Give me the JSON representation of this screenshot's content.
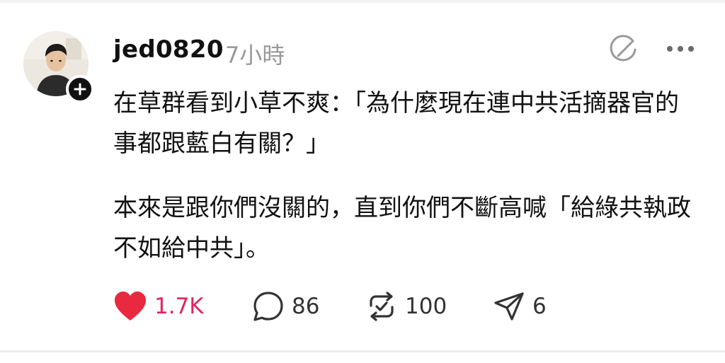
{
  "post": {
    "author": {
      "username": "jed0820",
      "timestamp": "7小時",
      "avatar_icon": "user-avatar-photo",
      "follow_icon": "plus-icon"
    },
    "paragraphs": [
      "在草群看到小草不爽：「為什麼現在連中共活摘器官的事都跟藍白有關？」",
      "本來是跟你們沒關的，直到你們不斷高喊「給綠共執政不如給中共」。"
    ],
    "header_actions": {
      "edit_icon": "edit-circle-icon",
      "more_icon": "more-horizontal-icon"
    },
    "actions": {
      "like": {
        "icon": "heart-icon",
        "count": "1.7K",
        "color": "#e8293f"
      },
      "reply": {
        "icon": "comment-icon",
        "count": "86"
      },
      "repost": {
        "icon": "repost-icon",
        "count": "100"
      },
      "share": {
        "icon": "send-icon",
        "count": "6"
      }
    }
  }
}
